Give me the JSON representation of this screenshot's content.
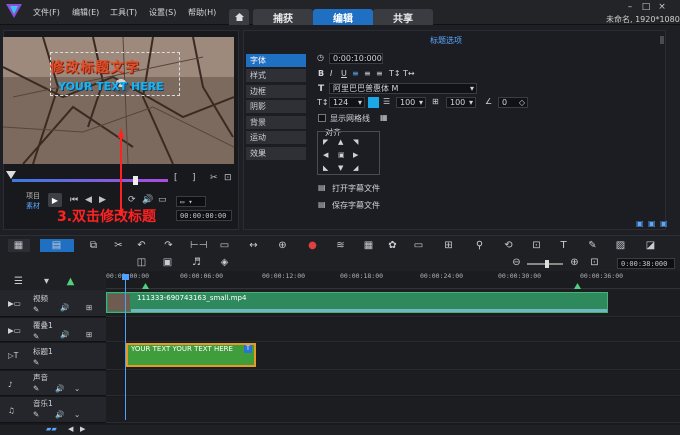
{
  "menu": {
    "file": "文件(F)",
    "edit": "编辑(E)",
    "tools": "工具(T)",
    "settings": "设置(S)",
    "help": "帮助(H)"
  },
  "tabs": {
    "capture": "捕获",
    "edit": "编辑",
    "share": "共享"
  },
  "project_title": "未命名, 1920*1080",
  "preview": {
    "title_cn": "修改标题文字",
    "title_en": "YOUR TEXT HERE",
    "annotation": "3.双击修改标题",
    "project_label": "项目",
    "material_label": "素材",
    "timecode": "00:00:00:00",
    "scrub_progress": 0.79
  },
  "options": {
    "header": "标题选项",
    "side_tabs": [
      "字体",
      "样式",
      "边框",
      "阴影",
      "背景",
      "运动",
      "效果"
    ],
    "duration": "0:00:10:000",
    "font_name": "阿里巴巴普惠体 M",
    "font_size": "124",
    "line_spacing": "100",
    "scale": "100",
    "rotation": "0",
    "show_grid": "显示网格线",
    "align_label": "对齐",
    "open_subtitle": "打开字幕文件",
    "save_subtitle": "保存字幕文件",
    "text_color": "#1aa9e6"
  },
  "timeline": {
    "zoom_time": "0:00:38:000",
    "ticks": [
      "00:00:00:00",
      "00:00:06:00",
      "00:00:12:00",
      "00:00:18:00",
      "00:00:24:00",
      "00:00:30:00",
      "00:00:36:00"
    ],
    "tracks": [
      "视频",
      "覆叠1",
      "标题1",
      "声音",
      "音乐1"
    ],
    "video_clip": "111333-690743163_small.mp4",
    "title_clip": "YOUR TEXT YOUR TEXT HERE"
  }
}
